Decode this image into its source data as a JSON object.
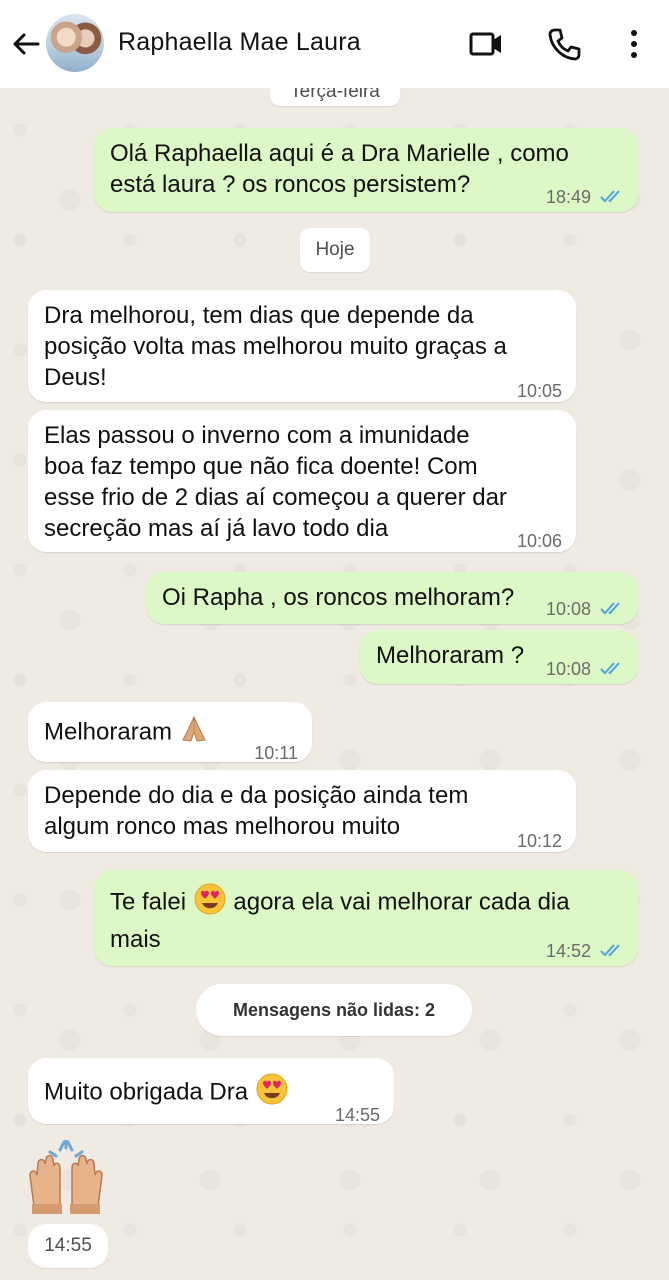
{
  "header": {
    "contact_name": "Raphaella Mae Laura",
    "icons": [
      "back-arrow-icon",
      "video-call-icon",
      "phone-icon",
      "more-vert-icon"
    ]
  },
  "chat": {
    "date_top": "Terça-feira",
    "date_today": "Hoje",
    "unread_banner": "Mensagens não lidas: 2",
    "messages": [
      {
        "dir": "out",
        "lines": [
          "Olá Raphaella aqui é a Dra Marielle , como",
          "está  laura ? os roncos persistem?"
        ],
        "time": "18:49",
        "status": "read"
      },
      {
        "dir": "in",
        "lines": [
          "Dra melhorou, tem dias que depende da",
          "posição volta mas melhorou muito graças a",
          "Deus!"
        ],
        "time": "10:05"
      },
      {
        "dir": "in",
        "lines": [
          "Elas passou o inverno com a imunidade",
          "boa faz tempo que não fica doente! Com",
          "esse frio de 2 dias aí começou a querer dar",
          "secreção mas aí já lavo todo dia"
        ],
        "time": "10:06"
      },
      {
        "dir": "out",
        "lines": [
          "Oi Rapha , os roncos melhoram?"
        ],
        "time": "10:08",
        "status": "read"
      },
      {
        "dir": "out",
        "lines": [
          "Melhoraram ?"
        ],
        "time": "10:08",
        "status": "read"
      },
      {
        "dir": "in",
        "lines": [
          "Melhoraram"
        ],
        "emoji": "folded-hands",
        "time": "10:11"
      },
      {
        "dir": "in",
        "lines": [
          "Depende do dia e da posição ainda tem",
          "algum ronco mas melhorou muito"
        ],
        "time": "10:12"
      },
      {
        "dir": "out",
        "line1_a": "Te falei",
        "line1_b": "agora ela vai melhorar cada dia",
        "line2": "mais",
        "emoji": "heart-eyes",
        "time": "14:52",
        "status": "read"
      },
      {
        "dir": "in",
        "lines": [
          "Muito obrigada Dra"
        ],
        "emoji": "heart-eyes",
        "time": "14:55"
      },
      {
        "dir": "in",
        "emoji": "raising-hands",
        "time": "14:55"
      }
    ]
  },
  "colors": {
    "outgoing_bubble": "#dcf8c6",
    "incoming_bubble": "#ffffff",
    "read_ticks": "#4fa3e0",
    "wallpaper": "#efeae2"
  }
}
